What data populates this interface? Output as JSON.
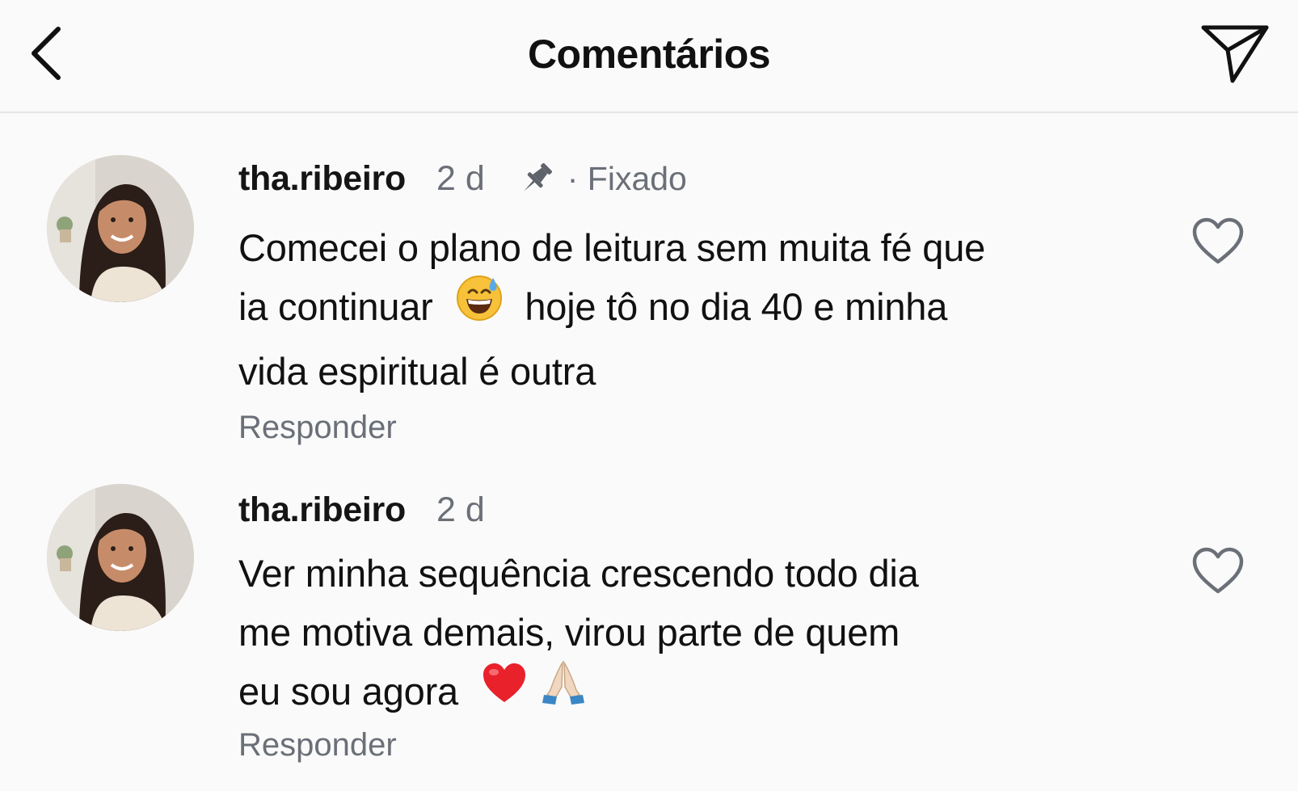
{
  "header": {
    "title": "Comentários",
    "back_icon": "chevron-left-icon",
    "send_icon": "paper-plane-icon"
  },
  "comments": [
    {
      "username": "tha.ribeiro",
      "time": "2 d",
      "pinned_label": "· Fixado",
      "text_line1": "Comecei o plano de leitura sem muita fé que",
      "text_line2_a": "ia continuar",
      "text_line2_emoji": "grinning-face-with-sweat",
      "text_line2_b": "hoje tô no dia 40 e minha",
      "text_line3": "vida espiritual é outra",
      "reply_label": "Responder",
      "liked": false
    },
    {
      "username": "tha.ribeiro",
      "time": "2 d",
      "text_line1": "Ver minha sequência crescendo todo dia",
      "text_line2": "me motiva demais, virou parte de quem",
      "text_line3_a": "eu sou agora",
      "text_line3_emojis": [
        "red-heart",
        "folded-hands"
      ],
      "reply_label": "Responder",
      "liked": false
    }
  ],
  "colors": {
    "background": "#fafafa",
    "text": "#111111",
    "secondary_text": "#6b6f78",
    "divider": "#e6e6e6"
  }
}
